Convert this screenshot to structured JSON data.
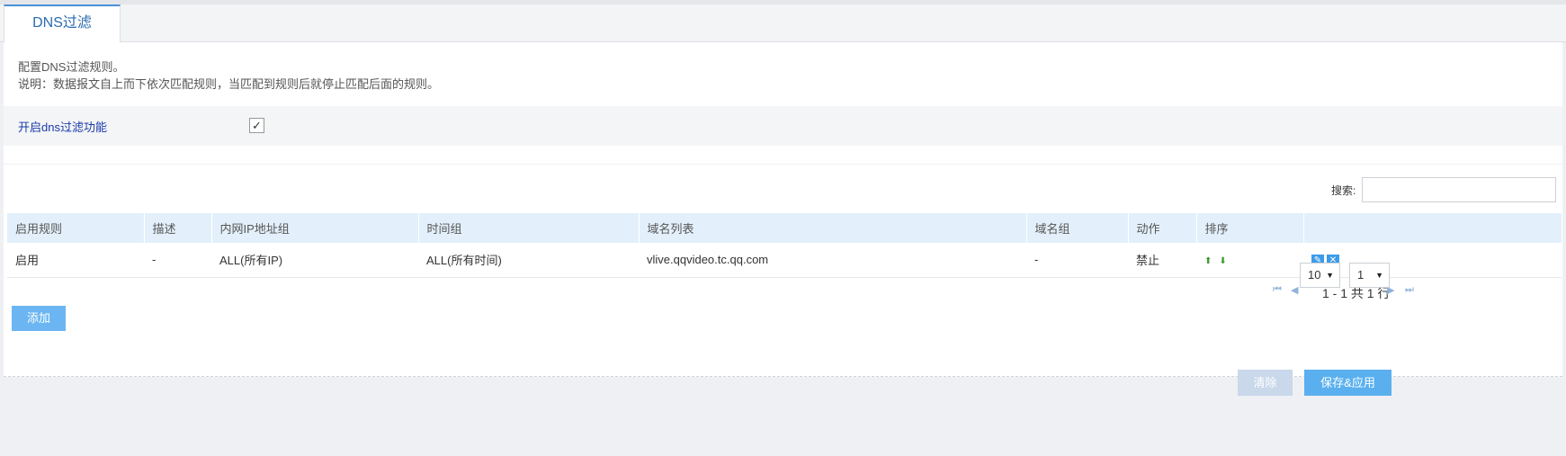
{
  "tab": {
    "label": "DNS过滤"
  },
  "description": {
    "line1": "配置DNS过滤规则。",
    "line2": "说明：数据报文自上而下依次匹配规则，当匹配到规则后就停止匹配后面的规则。"
  },
  "enable": {
    "label": "开启dns过滤功能",
    "checked": true,
    "check_glyph": "✓"
  },
  "search": {
    "label": "搜索:",
    "value": ""
  },
  "table": {
    "headers": [
      "启用规则",
      "描述",
      "内网IP地址组",
      "时间组",
      "域名列表",
      "域名组",
      "动作",
      "排序",
      ""
    ],
    "rows": [
      {
        "enabled": "启用",
        "desc": "-",
        "ip_group": "ALL(所有IP)",
        "time_group": "ALL(所有时间)",
        "domains": "vlive.qqvideo.tc.qq.com",
        "domain_group": "-",
        "action": "禁止"
      }
    ]
  },
  "pager": {
    "info": "1 - 1 共 1 行",
    "page_size": "10",
    "page": "1"
  },
  "buttons": {
    "add": "添加",
    "clear": "清除",
    "save": "保存&应用"
  },
  "colors": {
    "accent": "#4a90d9",
    "header_bg": "#e3f0fb",
    "button": "#5ab0ef",
    "button_disabled": "#c9d8ea"
  }
}
